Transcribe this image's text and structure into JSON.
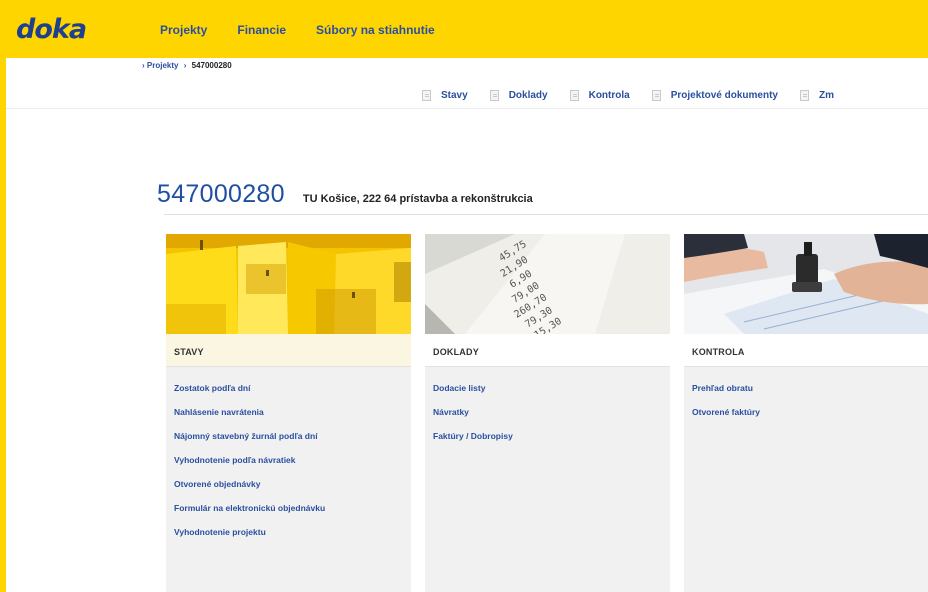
{
  "brand": {
    "logo": "doka"
  },
  "main_nav": [
    {
      "label": "Projekty"
    },
    {
      "label": "Financie"
    },
    {
      "label": "Súbory na stiahnutie"
    }
  ],
  "breadcrumb": {
    "parent": "Projekty",
    "current": "547000280"
  },
  "sub_nav": [
    {
      "label": "Stavy"
    },
    {
      "label": "Doklady"
    },
    {
      "label": "Kontrola"
    },
    {
      "label": "Projektové dokumenty"
    },
    {
      "label": "Zm"
    }
  ],
  "project": {
    "number": "547000280",
    "name": "TU Košice, 222 64 prístavba a rekonštrukcia"
  },
  "cards": [
    {
      "title": "STAVY",
      "links": [
        "Zostatok podľa dní",
        "Nahlásenie navrátenia",
        "Nájomný stavebný žurnál podľa dní",
        "Vyhodnotenie podľa návratiek",
        "Otvorené objednávky",
        "Formulár na elektronickú objednávku",
        "Vyhodnotenie projektu"
      ]
    },
    {
      "title": "DOKLADY",
      "links": [
        "Dodacie listy",
        "Návratky",
        "Faktúry / Dobropisy"
      ]
    },
    {
      "title": "KONTROLA",
      "links": [
        "Prehľad obratu",
        "Otvorené faktúry"
      ]
    }
  ],
  "receipt_numbers": [
    "45,75",
    "21,90",
    "6,90",
    "79,00",
    "260,70",
    "79,30",
    "15,30"
  ],
  "colors": {
    "brand_yellow": "#ffd500",
    "link_blue": "#2a4f9f",
    "logo_blue": "#1f3f8f",
    "title_blue": "#1f4fa0"
  }
}
